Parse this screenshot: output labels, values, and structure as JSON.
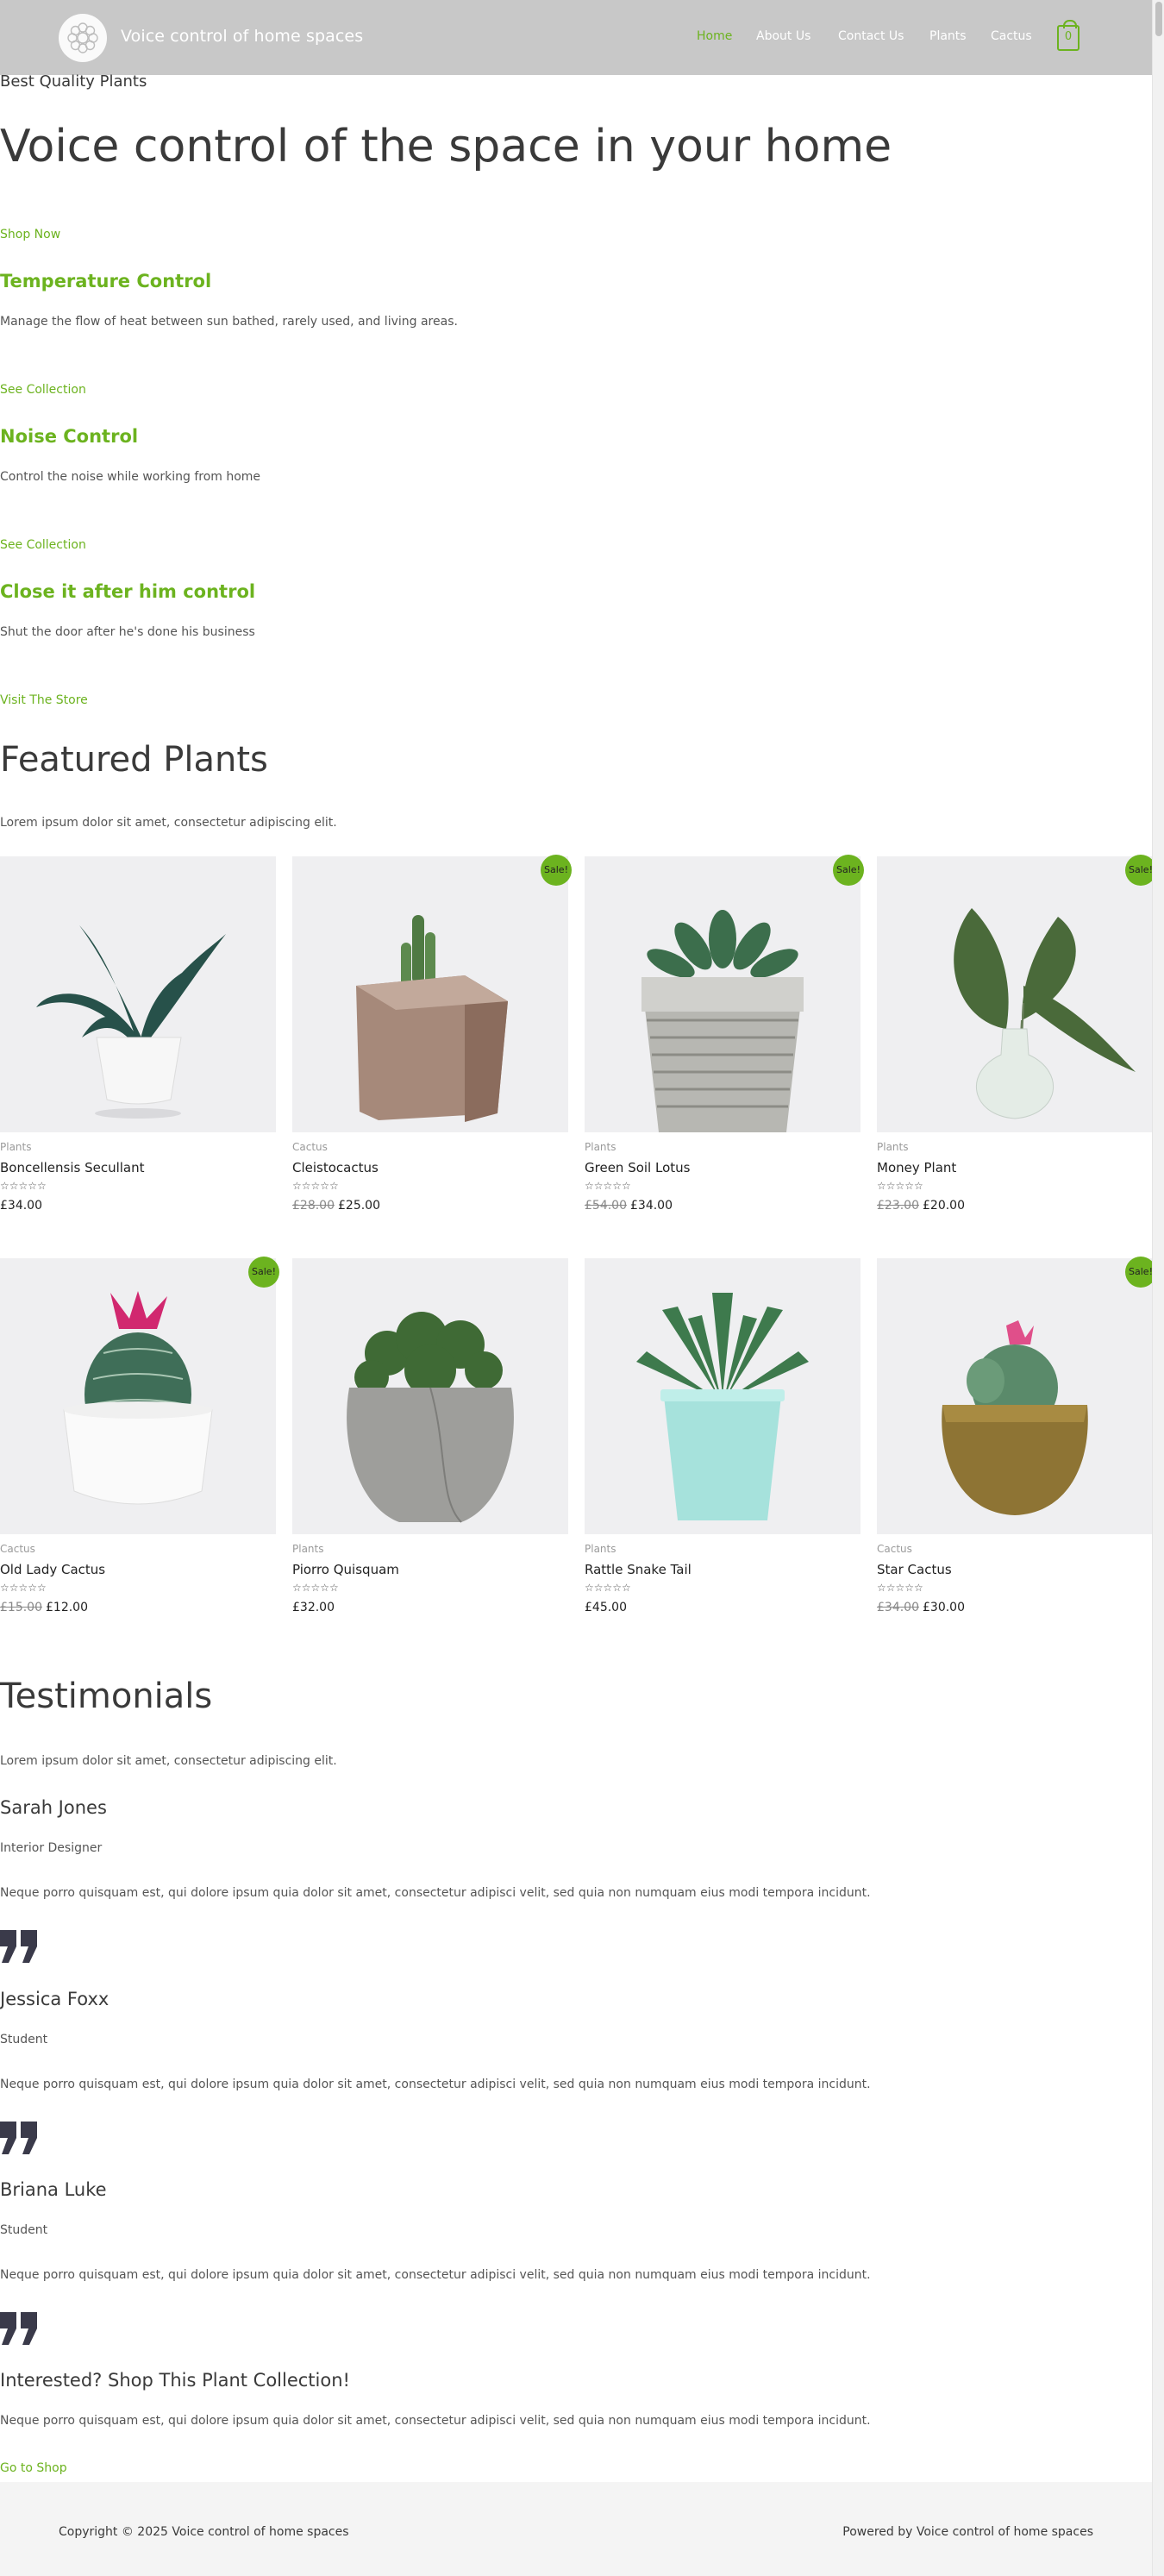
{
  "header": {
    "site_title": "Voice control of home spaces",
    "nav": [
      "Home",
      "About Us",
      "Contact Us",
      "Plants",
      "Cactus"
    ],
    "cart_count": "0"
  },
  "hero": {
    "kicker": "Best Quality Plants",
    "title": "Voice control of the space in your home",
    "cta": "Shop Now"
  },
  "features": [
    {
      "heading": "Temperature Control",
      "text": "Manage the flow of heat between sun bathed, rarely used, and living areas.",
      "link": "See Collection"
    },
    {
      "heading": "Noise Control",
      "text": "Control the noise while working from home",
      "link": "See Collection"
    },
    {
      "heading": "Close it after him control",
      "text": "Shut the door after he's done his business",
      "link": "Visit The Store"
    }
  ],
  "featured": {
    "title": "Featured Plants",
    "subtitle": "Lorem ipsum dolor sit amet, consectetur adipiscing elit."
  },
  "products": [
    {
      "category": "Plants",
      "name": "Boncellensis Secullant",
      "old_price": "",
      "price": "£34.00",
      "sale": false
    },
    {
      "category": "Cactus",
      "name": "Cleistocactus",
      "old_price": "£28.00",
      "price": "£25.00",
      "sale": true
    },
    {
      "category": "Plants",
      "name": "Green Soil Lotus",
      "old_price": "£54.00",
      "price": "£34.00",
      "sale": true
    },
    {
      "category": "Plants",
      "name": "Money Plant",
      "old_price": "£23.00",
      "price": "£20.00",
      "sale": true
    },
    {
      "category": "Cactus",
      "name": "Old Lady Cactus",
      "old_price": "£15.00",
      "price": "£12.00",
      "sale": true
    },
    {
      "category": "Plants",
      "name": "Piorro Quisquam",
      "old_price": "",
      "price": "£32.00",
      "sale": false
    },
    {
      "category": "Plants",
      "name": "Rattle Snake Tail",
      "old_price": "",
      "price": "£45.00",
      "sale": false
    },
    {
      "category": "Cactus",
      "name": "Star Cactus",
      "old_price": "£34.00",
      "price": "£30.00",
      "sale": true
    }
  ],
  "sale_label": "Sale!",
  "stars": "☆☆☆☆☆",
  "testimonials": {
    "title": "Testimonials",
    "subtitle": "Lorem ipsum dolor sit amet, consectetur adipiscing elit.",
    "items": [
      {
        "name": "Sarah Jones",
        "role": "Interior Designer",
        "text": "Neque porro quisquam est, qui dolore ipsum quia dolor sit amet, consectetur adipisci velit, sed quia non numquam eius modi tempora incidunt."
      },
      {
        "name": "Jessica Foxx",
        "role": "Student",
        "text": "Neque porro quisquam est, qui dolore ipsum quia dolor sit amet, consectetur adipisci velit, sed quia non numquam eius modi tempora incidunt."
      },
      {
        "name": "Briana Luke",
        "role": "Student",
        "text": "Neque porro quisquam est, qui dolore ipsum quia dolor sit amet, consectetur adipisci velit, sed quia non numquam eius modi tempora incidunt."
      }
    ]
  },
  "cta": {
    "title": "Interested? Shop This Plant Collection!",
    "text": "Neque porro quisquam est, qui dolore ipsum quia dolor sit amet, consectetur adipisci velit, sed quia non numquam eius modi tempora incidunt.",
    "link": "Go to Shop"
  },
  "footer": {
    "copyright": "Copyright © 2025 Voice control of home spaces",
    "powered": "Powered by Voice control of home spaces"
  },
  "colors": {
    "accent": "#6cb31f",
    "header_bg": "#c8c8c8",
    "footer_bg": "#f4f4f4",
    "text": "#3a3a3a"
  },
  "icons": [
    "logo-icon",
    "cart-icon",
    "quote-icon"
  ]
}
